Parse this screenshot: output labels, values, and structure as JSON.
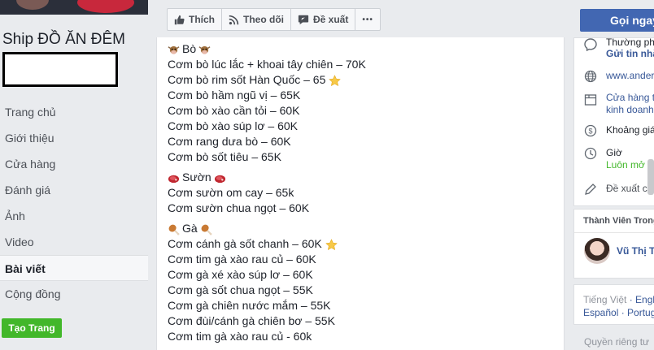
{
  "page": {
    "name": "Ship ĐỒ ĂN ĐÊM"
  },
  "nav": {
    "items": [
      {
        "label": "Trang chủ",
        "active": false
      },
      {
        "label": "Giới thiệu",
        "active": false
      },
      {
        "label": "Cửa hàng",
        "active": false
      },
      {
        "label": "Đánh giá",
        "active": false
      },
      {
        "label": "Ảnh",
        "active": false
      },
      {
        "label": "Video",
        "active": false
      },
      {
        "label": "Bài viết",
        "active": true
      },
      {
        "label": "Cộng đồng",
        "active": false
      }
    ],
    "create_page_label": "Tạo Trang"
  },
  "toolbar": {
    "like_label": "Thích",
    "follow_label": "Theo dõi",
    "suggest_label": "Đề xuất",
    "more_label": "•••"
  },
  "post": {
    "sections": [
      {
        "icon": "cow-emoji-icon",
        "heading": "Bò",
        "items": [
          {
            "text": "Cơm bò lúc lắc + khoai tây chiên – 70K"
          },
          {
            "text": "Cơm bò rim sốt Hàn Quốc – 65",
            "star": true
          },
          {
            "text": "Cơm bò hầm ngũ vị – 65K"
          },
          {
            "text": "Cơm bò xào cần tỏi – 60K"
          },
          {
            "text": "Cơm bò xào súp lơ – 60K"
          },
          {
            "text": "Cơm rang dưa bò – 60K"
          },
          {
            "text": "Cơm bò sốt tiêu – 65K"
          }
        ]
      },
      {
        "icon": "meat-emoji-icon",
        "heading": "Sườn",
        "items": [
          {
            "text": "Cơm sườn om cay – 65k"
          },
          {
            "text": "Cơm sườn chua ngọt – 60K"
          }
        ]
      },
      {
        "icon": "drumstick-emoji-icon",
        "heading": "Gà",
        "items": [
          {
            "text": "Cơm cánh gà sốt chanh – 60K",
            "star": true
          },
          {
            "text": "Cơm tim gà xào rau củ – 60K"
          },
          {
            "text": "Cơm gà xé xào súp lơ – 60K"
          },
          {
            "text": "Cơm gà sốt chua ngọt – 55K"
          },
          {
            "text": "Cơm gà chiên nước mắm – 55K"
          },
          {
            "text": "Cơm đùi/cánh gà chiên bơ – 55K"
          },
          {
            "text": "Cơm tim gà xào rau củ - 60k"
          }
        ]
      }
    ]
  },
  "sidebar": {
    "call_label": "Gọi ngay",
    "info": {
      "category_text": "Thường phản hồi",
      "send_message": "Gửi tin nhắn",
      "website": "www.anderson",
      "store_line1": "Cửa hàng tiện lợi",
      "store_line2": "kinh doanh",
      "price_range": "Khoảng giá",
      "hours_label": "Giờ",
      "hours_status": "Luôn mở cửa",
      "suggest_edit": "Đề xuất chỉnh sửa"
    },
    "members": {
      "title": "Thành Viên Trong",
      "name": "Vũ Thị T"
    },
    "languages": {
      "current": "Tiếng Việt",
      "line1_other": "English",
      "line2": "Español · Português"
    },
    "privacy": "Quyền riêng tư"
  },
  "colors": {
    "accent_blue": "#4267b2",
    "link_blue": "#385898",
    "green": "#42b72a",
    "background": "#e9ebee"
  }
}
